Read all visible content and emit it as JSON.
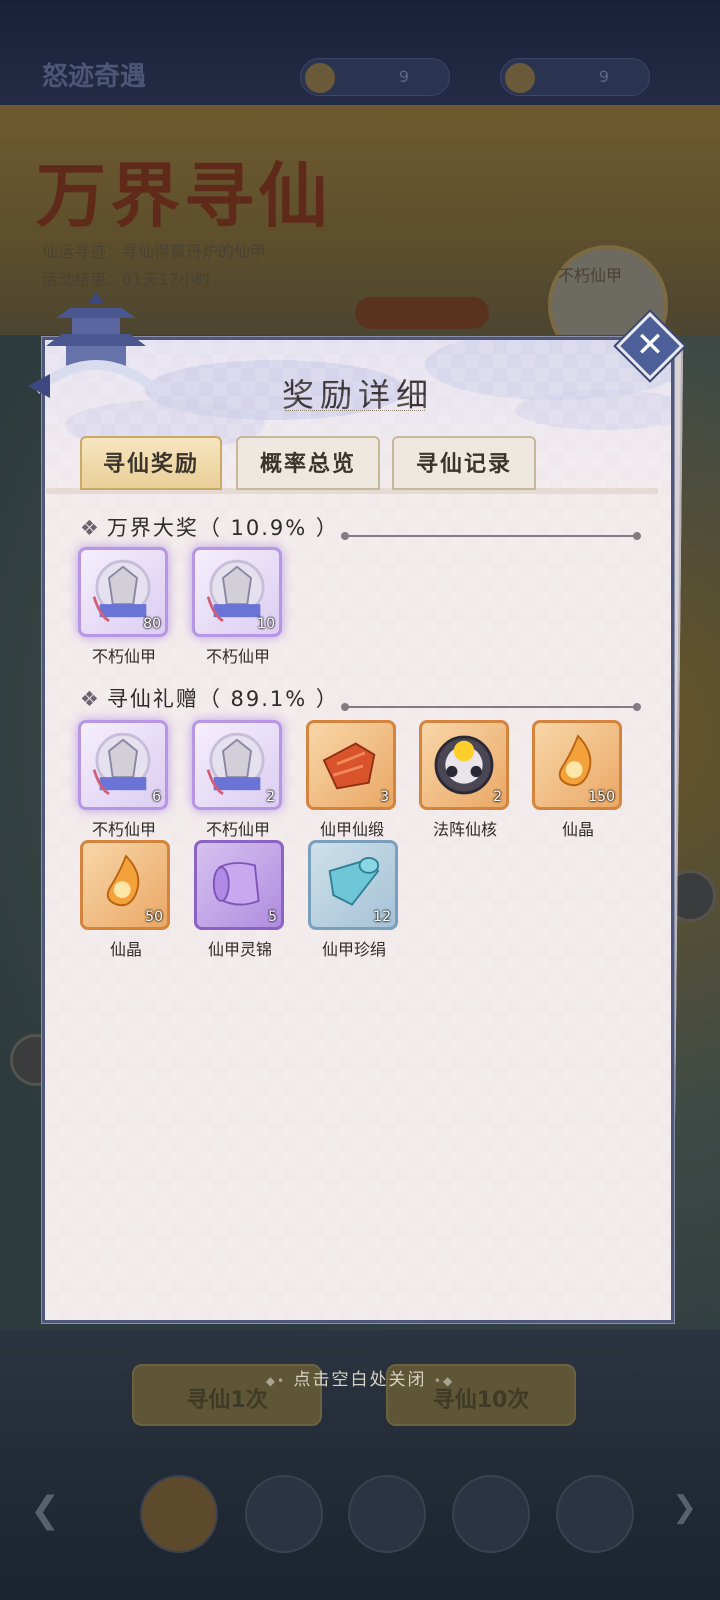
{
  "background": {
    "title": "怒迹奇遇",
    "resource_values": [
      "9",
      "9"
    ],
    "banner_title": "万界寻仙",
    "banner_subtitle_1": "仙运寻迹：寻仙得赢丹炉的仙甲",
    "banner_subtitle_2": "活动结束：01天17小时",
    "character_label": "不朽仙甲",
    "draw_once_label": "寻仙1次",
    "draw_ten_label": "寻仙10次"
  },
  "dialog": {
    "title": "奖励详细",
    "tabs": [
      {
        "label": "寻仙奖励",
        "active": true
      },
      {
        "label": "概率总览",
        "active": false
      },
      {
        "label": "寻仙记录",
        "active": false
      }
    ],
    "sections": [
      {
        "title": "万界大奖",
        "rate": "（ 10.9% ）",
        "items": [
          {
            "name": "不朽仙甲",
            "qty": "80",
            "icon": "armor-icon",
            "tier": "purple"
          },
          {
            "name": "不朽仙甲",
            "qty": "10",
            "icon": "armor-icon",
            "tier": "purple"
          }
        ]
      },
      {
        "title": "寻仙礼赠",
        "rate": "（ 89.1% ）",
        "items": [
          {
            "name": "不朽仙甲",
            "qty": "6",
            "icon": "armor-icon",
            "tier": "purple"
          },
          {
            "name": "不朽仙甲",
            "qty": "2",
            "icon": "armor-icon",
            "tier": "purple"
          },
          {
            "name": "仙甲仙缎",
            "qty": "3",
            "icon": "satin-icon",
            "tier": "orange"
          },
          {
            "name": "法阵仙核",
            "qty": "2",
            "icon": "core-icon",
            "tier": "orange"
          },
          {
            "name": "仙晶",
            "qty": "150",
            "icon": "crystal-icon",
            "tier": "orange"
          },
          {
            "name": "仙晶",
            "qty": "50",
            "icon": "crystal-icon",
            "tier": "orange"
          },
          {
            "name": "仙甲灵锦",
            "qty": "5",
            "icon": "brocade-icon",
            "tier": "violet"
          },
          {
            "name": "仙甲珍绢",
            "qty": "12",
            "icon": "silk-icon",
            "tier": "blue"
          }
        ]
      }
    ]
  },
  "close_hint": "点击空白处关闭"
}
